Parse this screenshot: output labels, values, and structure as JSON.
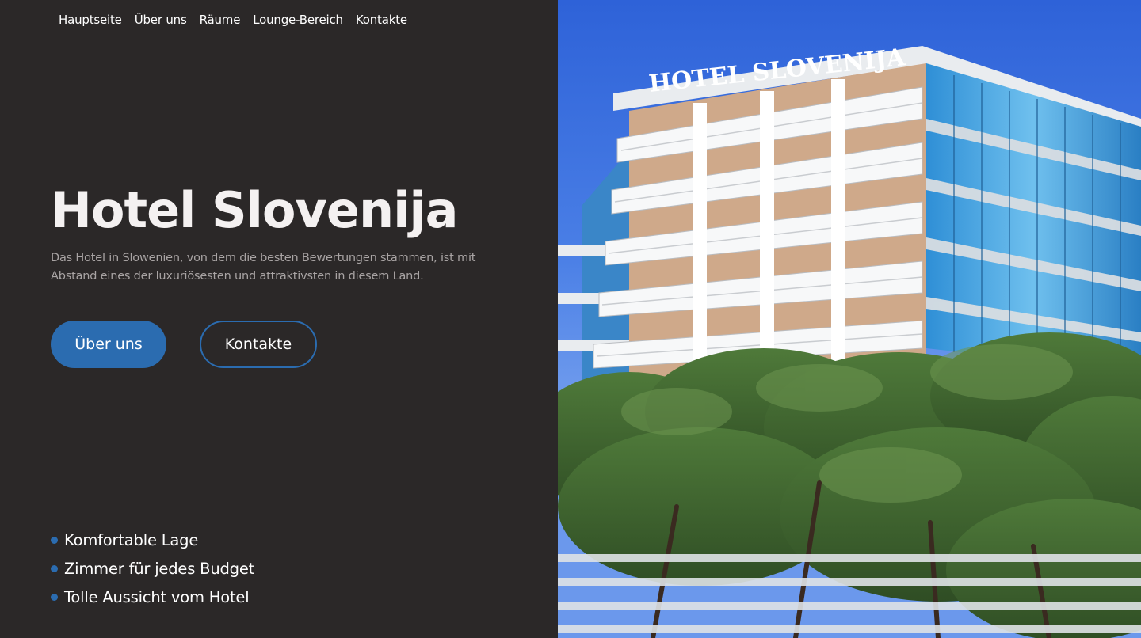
{
  "nav": {
    "items": [
      "Hauptseite",
      "Über uns",
      "Räume",
      "Lounge-Bereich",
      "Kontakte"
    ]
  },
  "hero": {
    "title": "Hotel Slovenija",
    "description": "Das Hotel in Slowenien, von dem die besten Bewertungen stammen, ist mit Abstand eines der luxuriösesten und attraktivsten in diesem Land.",
    "primary_button": "Über uns",
    "secondary_button": "Kontakte"
  },
  "features": [
    "Komfortable Lage",
    "Zimmer für jedes Budget",
    "Tolle Aussicht vom Hotel"
  ],
  "photo": {
    "sign_text": "HOTEL SLOVENIJA"
  },
  "colors": {
    "background": "#2b2828",
    "accent": "#2b6cb0",
    "muted_text": "#a9a4a4"
  }
}
